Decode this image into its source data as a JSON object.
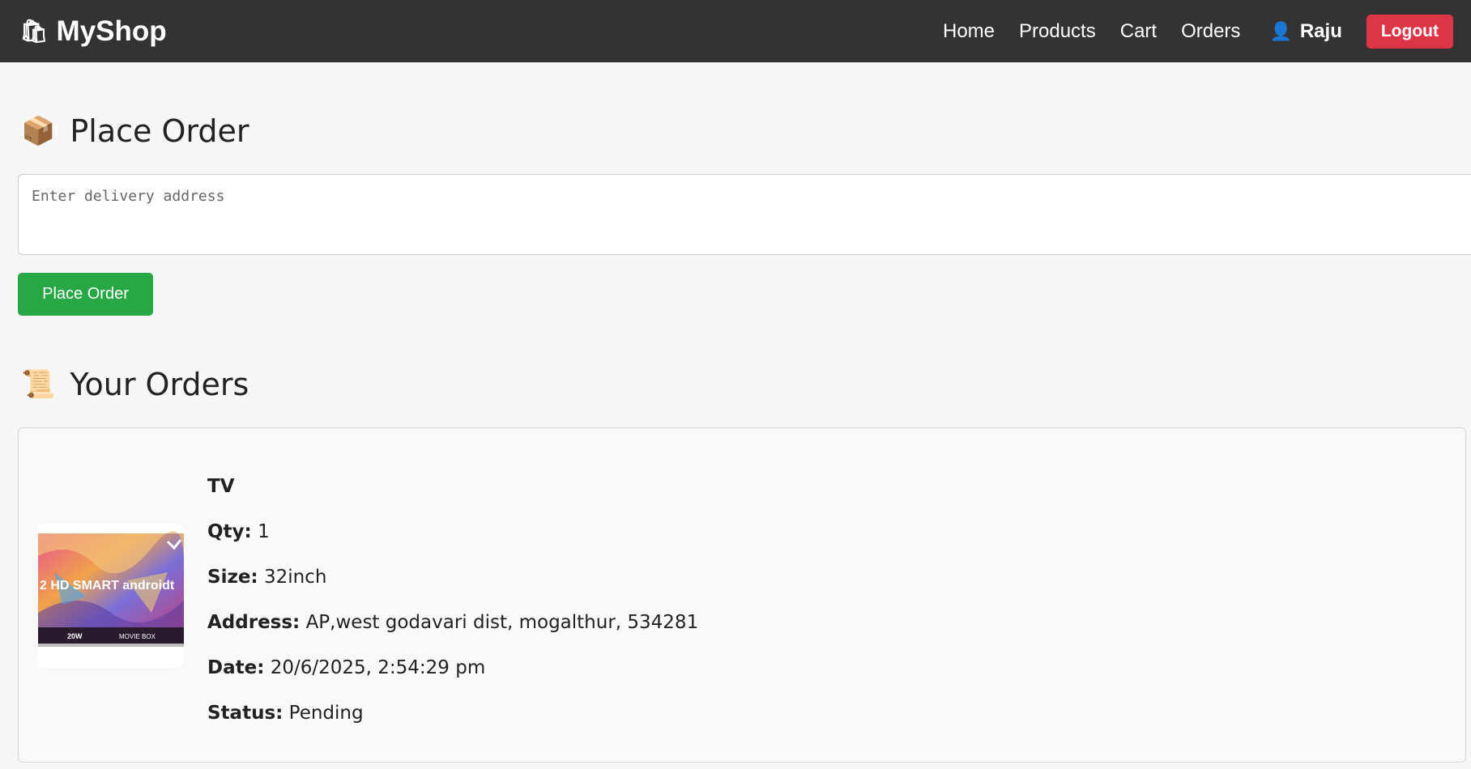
{
  "navbar": {
    "brand_icon": "shop-bag-icon",
    "brand": "MyShop",
    "links": [
      "Home",
      "Products",
      "Cart",
      "Orders"
    ],
    "user_icon": "user-silhouette-icon",
    "username": "Raju",
    "logout_label": "Logout"
  },
  "place_order": {
    "icon": "package-icon",
    "title": "Place Order",
    "address_placeholder": "Enter delivery address",
    "button_label": "Place Order"
  },
  "orders": {
    "icon": "scroll-icon",
    "title": "Your Orders",
    "items": [
      {
        "product_name": "TV",
        "qty_label": "Qty:",
        "qty": "1",
        "size_label": "Size:",
        "size": "32inch",
        "address_label": "Address:",
        "address": "AP,west godavari dist, mogalthur, 534281",
        "date_label": "Date:",
        "date": "20/6/2025, 2:54:29 pm",
        "status_label": "Status:",
        "status": "Pending",
        "image_text": "2 HD SMART androidt",
        "image_strip": [
          "20W",
          "MOVIE BOX"
        ]
      }
    ]
  },
  "colors": {
    "navbar_bg": "#333333",
    "logout_bg": "#dc3545",
    "place_order_bg": "#28a745",
    "page_bg": "#f7f7f7"
  }
}
